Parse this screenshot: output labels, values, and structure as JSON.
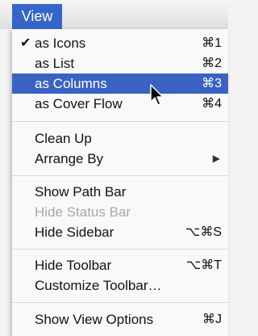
{
  "menubar": {
    "title": "View"
  },
  "menu": {
    "items": [
      {
        "label": "as Icons",
        "shortcut": "⌘1",
        "checked": "✔"
      },
      {
        "label": "as List",
        "shortcut": "⌘2"
      },
      {
        "label": "as Columns",
        "shortcut": "⌘3",
        "highlighted": true
      },
      {
        "label": "as Cover Flow",
        "shortcut": "⌘4"
      },
      {
        "label": "Clean Up"
      },
      {
        "label": "Arrange By",
        "submenu_icon": "right-triangle-icon",
        "arrow": "▶"
      },
      {
        "label": "Show Path Bar"
      },
      {
        "label": "Hide Status Bar",
        "disabled": true
      },
      {
        "label": "Hide Sidebar",
        "shortcut": "⌥⌘S"
      },
      {
        "label": "Hide Toolbar",
        "shortcut": "⌥⌘T"
      },
      {
        "label": "Customize Toolbar…"
      },
      {
        "label": "Show View Options",
        "shortcut": "⌘J"
      }
    ]
  },
  "colors": {
    "highlight": "#3a62c2",
    "menu_title_bg": "#3565c9",
    "disabled_text": "#a8a8a8"
  }
}
